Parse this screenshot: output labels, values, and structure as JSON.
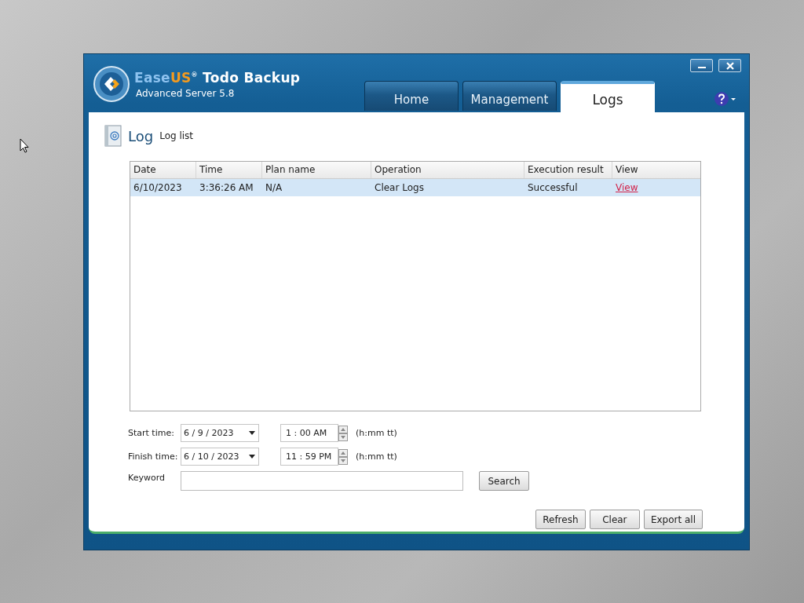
{
  "app": {
    "brand_first": "Ease",
    "brand_second": "US",
    "brand_mark": "®",
    "product": "Todo Backup",
    "edition": "Advanced Server 5.8"
  },
  "tabs": [
    {
      "label": "Home",
      "selected": false
    },
    {
      "label": "Management",
      "selected": false
    },
    {
      "label": "Logs",
      "selected": true
    }
  ],
  "header": {
    "title": "Log",
    "subtitle": "Log list"
  },
  "table": {
    "columns": [
      "Date",
      "Time",
      "Plan name",
      "Operation",
      "Execution result",
      "View"
    ],
    "rows": [
      {
        "cells": [
          "6/10/2023",
          "3:36:26 AM",
          "N/A",
          "Clear Logs",
          "Successful"
        ],
        "link": "View",
        "selected": true
      }
    ]
  },
  "filters": {
    "start_label": "Start time:",
    "start_date": "6 / 9 / 2023",
    "start_time": "1  : 00  AM",
    "finish_label": "Finish time:",
    "finish_date": "6 / 10 / 2023",
    "finish_time": "11 : 59  PM",
    "format_start": "(h:mm tt)",
    "format_finish": "(h:mm tt)",
    "keyword_label": "Keyword",
    "search_button": "Search"
  },
  "buttons": [
    "Refresh",
    "Clear",
    "Export all"
  ]
}
